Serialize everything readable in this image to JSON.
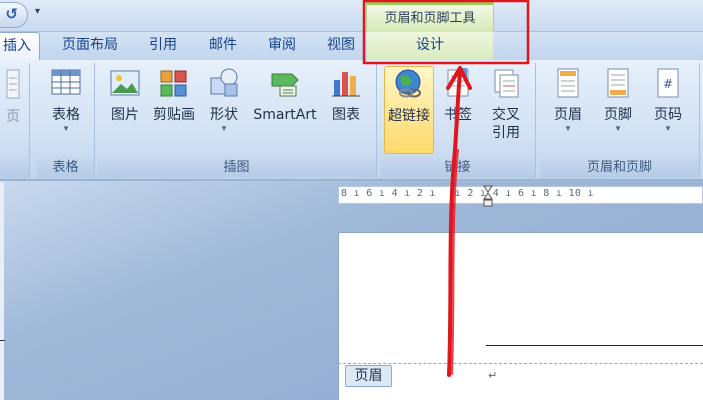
{
  "quick_access": {
    "dropdown_glyph": "▾"
  },
  "context_tab_group": {
    "title": "页眉和页脚工具"
  },
  "tabs": [
    {
      "label": "插入",
      "state": "active"
    },
    {
      "label": "页面布局"
    },
    {
      "label": "引用"
    },
    {
      "label": "邮件"
    },
    {
      "label": "审阅"
    },
    {
      "label": "视图"
    },
    {
      "label": "设计",
      "state": "contextual"
    }
  ],
  "ribbon": {
    "group_pages": {
      "button": "页"
    },
    "group_table": {
      "label": "表格",
      "button": "表格"
    },
    "group_illustrations": {
      "label": "插图",
      "buttons": [
        "图片",
        "剪贴画",
        "形状",
        "SmartArt",
        "图表"
      ]
    },
    "group_links": {
      "label": "链接",
      "buttons": [
        "超链接",
        "书签",
        "交叉",
        "引用"
      ],
      "highlighted": "超链接"
    },
    "group_header_footer": {
      "label": "页眉和页脚",
      "buttons": [
        "页眉",
        "页脚",
        "页码"
      ]
    }
  },
  "ruler": {
    "text": "8 ı 6 ı 4 ı 2 ı   ı 2 ı 4 ı 6 ı 8 ı 10 ı"
  },
  "document": {
    "header_tag": "页眉",
    "para_mark": "↵"
  },
  "colors": {
    "annotation_red": "#e0151d",
    "context_green": "#9acb55"
  }
}
